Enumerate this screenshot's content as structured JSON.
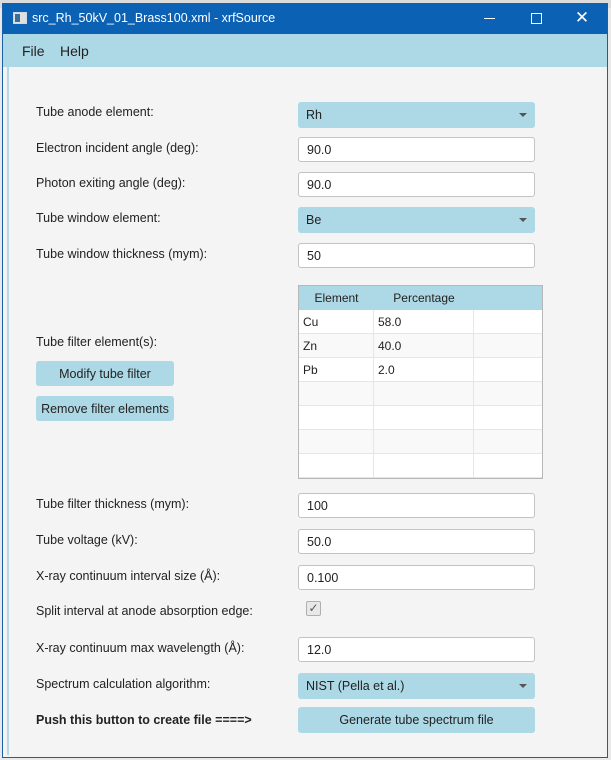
{
  "window": {
    "title": "src_Rh_50kV_01_Brass100.xml - xrfSource",
    "controls": {
      "minimize": "minimize-icon",
      "maximize": "maximize-icon",
      "close": "close-icon",
      "close_glyph": "✕"
    }
  },
  "menu": {
    "items": [
      "File",
      "Help"
    ]
  },
  "form": {
    "tube_anode": {
      "label": "Tube anode element:",
      "value": "Rh"
    },
    "electron_angle": {
      "label": "Electron incident angle (deg):",
      "value": "90.0"
    },
    "photon_angle": {
      "label": "Photon exiting angle (deg):",
      "value": "90.0"
    },
    "window_element": {
      "label": "Tube window element:",
      "value": "Be"
    },
    "window_thickness": {
      "label": "Tube window thickness (mym):",
      "value": "50"
    },
    "filter_elements": {
      "label": "Tube filter element(s):",
      "modify_button": "Modify tube filter",
      "remove_button": "Remove filter elements",
      "table": {
        "headers": [
          "Element",
          "Percentage",
          ""
        ],
        "rows": [
          [
            "Cu",
            "58.0",
            ""
          ],
          [
            "Zn",
            "40.0",
            ""
          ],
          [
            "Pb",
            "2.0",
            ""
          ],
          [
            "",
            "",
            ""
          ],
          [
            "",
            "",
            ""
          ],
          [
            "",
            "",
            ""
          ],
          [
            "",
            "",
            ""
          ]
        ]
      }
    },
    "filter_thickness": {
      "label": "Tube filter thickness (mym):",
      "value": "100"
    },
    "tube_voltage": {
      "label": "Tube voltage (kV):",
      "value": "50.0"
    },
    "interval_size": {
      "label": "X-ray continuum interval size (Å):",
      "value": "0.100"
    },
    "split_interval": {
      "label": "Split interval at anode absorption edge:",
      "checked": true,
      "check_glyph": "✓"
    },
    "max_wavelength": {
      "label": "X-ray continuum max wavelength (Å):",
      "value": "12.0"
    },
    "algorithm": {
      "label": "Spectrum calculation algorithm:",
      "value": "NIST (Pella et al.)"
    },
    "generate": {
      "label": "Push this button to create file ====>",
      "button": "Generate tube spectrum file"
    }
  }
}
